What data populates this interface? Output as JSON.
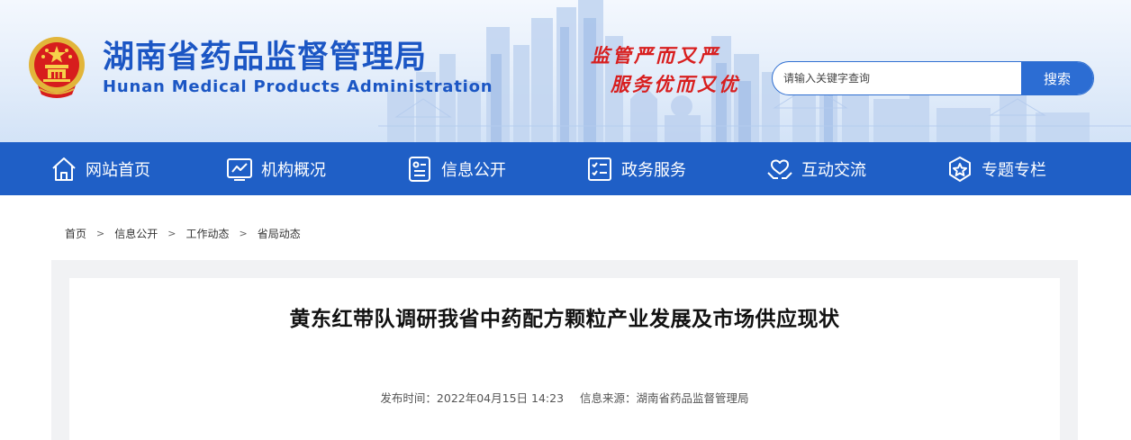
{
  "header": {
    "title": "湖南省药品监督管理局",
    "subtitle": "Hunan Medical Products Administration",
    "slogan_line1": "监管严而又严",
    "slogan_line2": "服务优而又优",
    "emblem_icon": "national-emblem-icon"
  },
  "search": {
    "placeholder": "请输入关键字查询",
    "button_label": "搜索"
  },
  "nav": {
    "items": [
      {
        "label": "网站首页",
        "icon": "home-icon"
      },
      {
        "label": "机构概况",
        "icon": "chart-monitor-icon"
      },
      {
        "label": "信息公开",
        "icon": "info-card-icon"
      },
      {
        "label": "政务服务",
        "icon": "checklist-icon"
      },
      {
        "label": "互动交流",
        "icon": "heart-hands-icon"
      },
      {
        "label": "专题专栏",
        "icon": "star-badge-icon"
      }
    ]
  },
  "breadcrumb": {
    "items": [
      "首页",
      "信息公开",
      "工作动态",
      "省局动态"
    ],
    "separator": ">"
  },
  "article": {
    "title": "黄东红带队调研我省中药配方颗粒产业发展及市场供应现状",
    "publish_time": "发布时间：2022年04月15日 14:23",
    "source": "信息来源：湖南省药品监督管理局"
  },
  "colors": {
    "brand_blue": "#1f5fc6",
    "title_blue": "#1b56c4",
    "slogan_red": "#d81e1e"
  }
}
